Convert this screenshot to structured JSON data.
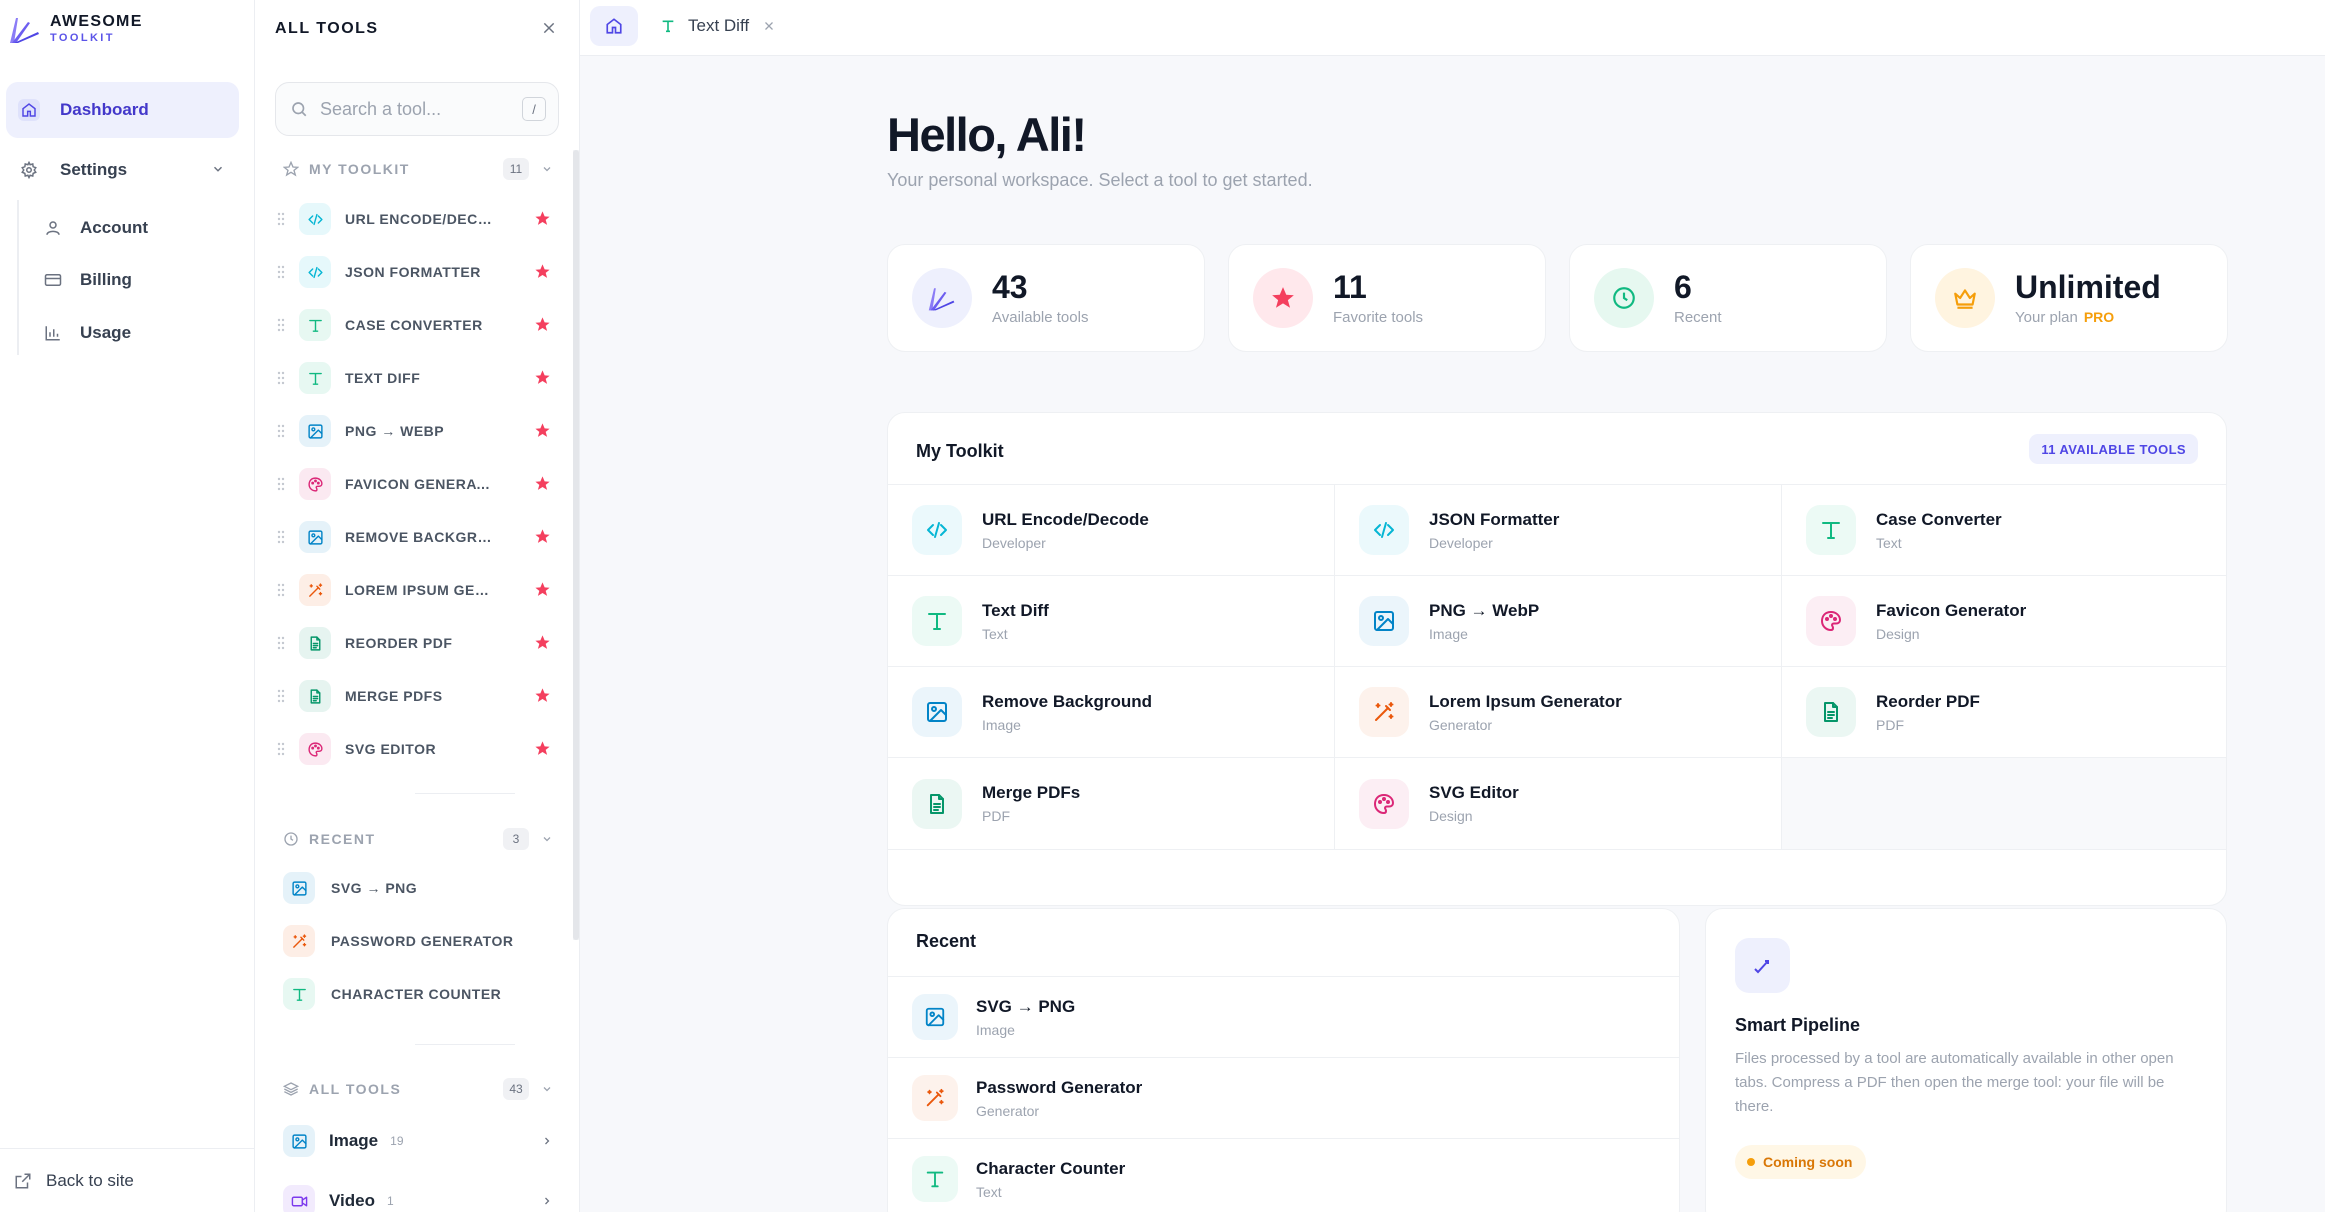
{
  "brand": {
    "line1": "AWESOME",
    "line2": "TOOLKIT"
  },
  "nav": {
    "dashboard": "Dashboard",
    "settings": "Settings",
    "sub": [
      "Account",
      "Billing",
      "Usage"
    ],
    "back": "Back to site"
  },
  "panel": {
    "title": "ALL TOOLS",
    "search_placeholder": "Search a tool...",
    "search_kbd": "/",
    "toolkit_label": "MY TOOLKIT",
    "toolkit_count": "11",
    "toolkit_items": [
      {
        "label": "URL ENCODE/DECODE",
        "icon": "code"
      },
      {
        "label": "JSON FORMATTER",
        "icon": "code"
      },
      {
        "label": "CASE CONVERTER",
        "icon": "text"
      },
      {
        "label": "TEXT DIFF",
        "icon": "text"
      },
      {
        "label": "PNG → WEBP",
        "icon": "image"
      },
      {
        "label": "FAVICON GENERATOR",
        "icon": "palette"
      },
      {
        "label": "REMOVE BACKGROUND",
        "icon": "image"
      },
      {
        "label": "LOREM IPSUM GENERATOR",
        "icon": "wand"
      },
      {
        "label": "REORDER PDF",
        "icon": "pdf"
      },
      {
        "label": "MERGE PDFS",
        "icon": "pdf"
      },
      {
        "label": "SVG EDITOR",
        "icon": "palette"
      }
    ],
    "recent_label": "RECENT",
    "recent_count": "3",
    "recent_items": [
      {
        "label": "SVG → PNG",
        "icon": "image"
      },
      {
        "label": "PASSWORD GENERATOR",
        "icon": "wand"
      },
      {
        "label": "CHARACTER COUNTER",
        "icon": "text"
      }
    ],
    "all_label": "ALL TOOLS",
    "all_count": "43",
    "categories": [
      {
        "label": "Image",
        "count": "19",
        "icon": "image"
      },
      {
        "label": "Video",
        "count": "1",
        "icon": "video"
      }
    ]
  },
  "tabs": {
    "active_label": "Text Diff"
  },
  "main": {
    "greeting": "Hello, Ali!",
    "subtitle": "Your personal workspace. Select a tool to get started.",
    "stats": [
      {
        "value": "43",
        "label": "Available tools",
        "icon": "logo"
      },
      {
        "value": "11",
        "label": "Favorite tools",
        "icon": "star"
      },
      {
        "value": "6",
        "label": "Recent",
        "icon": "clock"
      },
      {
        "value": "Unlimited",
        "label": "Your plan",
        "extra": "PRO",
        "icon": "crown"
      }
    ],
    "toolkit": {
      "title": "My Toolkit",
      "badge": "11 AVAILABLE TOOLS",
      "tools": [
        {
          "name": "URL Encode/Decode",
          "cat": "Developer",
          "icon": "code"
        },
        {
          "name": "JSON Formatter",
          "cat": "Developer",
          "icon": "code"
        },
        {
          "name": "Case Converter",
          "cat": "Text",
          "icon": "text"
        },
        {
          "name": "Text Diff",
          "cat": "Text",
          "icon": "text"
        },
        {
          "name": "PNG → WebP",
          "cat": "Image",
          "icon": "image"
        },
        {
          "name": "Favicon Generator",
          "cat": "Design",
          "icon": "palette"
        },
        {
          "name": "Remove Background",
          "cat": "Image",
          "icon": "image"
        },
        {
          "name": "Lorem Ipsum Generator",
          "cat": "Generator",
          "icon": "wand"
        },
        {
          "name": "Reorder PDF",
          "cat": "PDF",
          "icon": "pdf"
        },
        {
          "name": "Merge PDFs",
          "cat": "PDF",
          "icon": "pdf"
        },
        {
          "name": "SVG Editor",
          "cat": "Design",
          "icon": "palette"
        }
      ]
    },
    "recent": {
      "title": "Recent",
      "items": [
        {
          "name": "SVG → PNG",
          "cat": "Image",
          "icon": "image"
        },
        {
          "name": "Password Generator",
          "cat": "Generator",
          "icon": "wand"
        },
        {
          "name": "Character Counter",
          "cat": "Text",
          "icon": "text"
        }
      ]
    },
    "pipeline": {
      "title": "Smart Pipeline",
      "description": "Files processed by a tool are automatically available in other open tabs. Compress a PDF then open the merge tool: your file will be there.",
      "badge": "Coming soon"
    }
  },
  "colors": {
    "accent": "#4f46e5",
    "code": "#06b6d4",
    "text": "#10b981",
    "image": "#0284c7",
    "palette": "#db2777",
    "wand": "#ea580c",
    "pdf": "#059669",
    "video": "#7c3aed",
    "star": "#f43f5e",
    "pro": "#f59e0b"
  }
}
